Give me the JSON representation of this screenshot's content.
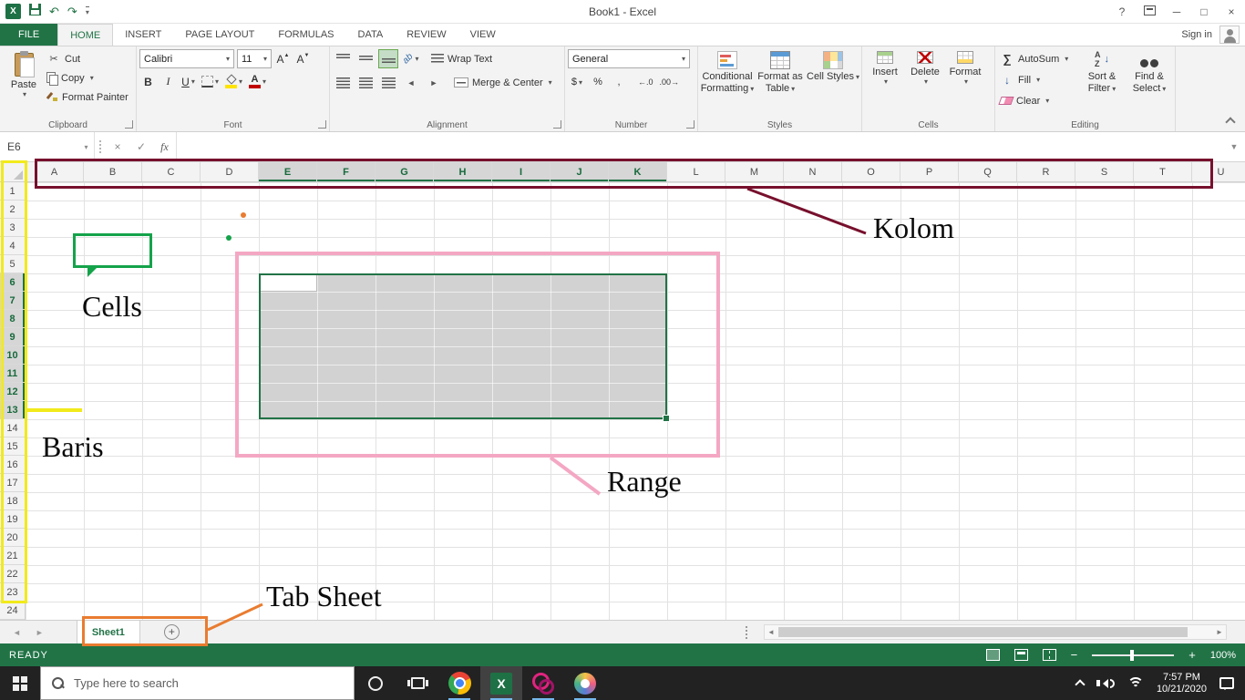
{
  "window": {
    "title": "Book1 - Excel",
    "sign_in": "Sign in"
  },
  "ribbon_tabs": [
    {
      "label": "FILE",
      "state": "file"
    },
    {
      "label": "HOME",
      "state": "active"
    },
    {
      "label": "INSERT",
      "state": ""
    },
    {
      "label": "PAGE LAYOUT",
      "state": ""
    },
    {
      "label": "FORMULAS",
      "state": ""
    },
    {
      "label": "DATA",
      "state": ""
    },
    {
      "label": "REVIEW",
      "state": ""
    },
    {
      "label": "VIEW",
      "state": ""
    }
  ],
  "ribbon": {
    "clipboard": {
      "group": "Clipboard",
      "paste": "Paste",
      "cut": "Cut",
      "copy": "Copy",
      "format_painter": "Format Painter"
    },
    "font": {
      "group": "Font",
      "name": "Calibri",
      "size": "11"
    },
    "alignment": {
      "group": "Alignment",
      "wrap_text": "Wrap Text",
      "merge_center": "Merge & Center"
    },
    "number": {
      "group": "Number",
      "format": "General"
    },
    "styles": {
      "group": "Styles",
      "conditional": "Conditional Formatting",
      "format_table": "Format as Table",
      "cell_styles": "Cell Styles"
    },
    "cells": {
      "group": "Cells",
      "insert": "Insert",
      "delete": "Delete",
      "format": "Format"
    },
    "editing": {
      "group": "Editing",
      "autosum": "AutoSum",
      "fill": "Fill",
      "clear": "Clear",
      "sort_filter": "Sort & Filter",
      "find_select": "Find & Select"
    }
  },
  "formula_bar": {
    "name_box": "E6",
    "fx": "fx"
  },
  "grid": {
    "columns": [
      "A",
      "B",
      "C",
      "D",
      "E",
      "F",
      "G",
      "H",
      "I",
      "J",
      "K",
      "L",
      "M",
      "N",
      "O",
      "P",
      "Q",
      "R",
      "S",
      "T",
      "U"
    ],
    "selected_columns": [
      "E",
      "F",
      "G",
      "H",
      "I",
      "J",
      "K"
    ],
    "row_count": 24,
    "selected_rows": [
      6,
      7,
      8,
      9,
      10,
      11,
      12,
      13
    ],
    "active_cell": "E6"
  },
  "sheet_bar": {
    "sheet": "Sheet1",
    "add_sheet": "+"
  },
  "status_bar": {
    "mode": "READY",
    "zoom_level": "100%"
  },
  "taskbar": {
    "search_placeholder": "Type here to search",
    "time": "7:57 PM",
    "date": "10/21/2020"
  },
  "annotations": {
    "kolom": {
      "label": "Kolom",
      "color": "#77102d"
    },
    "cells": {
      "label": "Cells",
      "color": "#14a34a"
    },
    "baris": {
      "label": "Baris",
      "color": "#f2ea1b"
    },
    "range": {
      "label": "Range",
      "color": "#f4a7c3"
    },
    "tab_sheet": {
      "label": "Tab Sheet",
      "color": "#e97c30"
    }
  },
  "icons": {
    "dropdown": "▾",
    "undo": "↶",
    "redo": "↷",
    "help": "?",
    "minimize": "─",
    "maximize": "□",
    "close": "×",
    "scissors": "✂",
    "bold": "B",
    "italic": "I",
    "underline": "U",
    "letter_A": "A",
    "arrow_up_small": "▲",
    "arrow_down_small": "▼",
    "cancel": "×",
    "enter": "✓",
    "sum": "∑",
    "fill_arrow": "↓",
    "dollar": "$",
    "percent": "%",
    "comma": ",",
    "increase_decimal": "←.0",
    "decrease_decimal": ".00→",
    "plus": "+",
    "minus": "−",
    "excel_x": "X",
    "left_arrow": "◄",
    "right_arrow": "►",
    "letter_a_sort": "A",
    "letter_z_sort": "Z",
    "orientation": "ab"
  }
}
